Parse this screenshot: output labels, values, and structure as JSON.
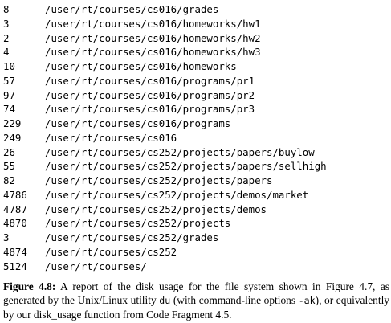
{
  "listing": [
    {
      "size": "8",
      "path": "/user/rt/courses/cs016/grades"
    },
    {
      "size": "3",
      "path": "/user/rt/courses/cs016/homeworks/hw1"
    },
    {
      "size": "2",
      "path": "/user/rt/courses/cs016/homeworks/hw2"
    },
    {
      "size": "4",
      "path": "/user/rt/courses/cs016/homeworks/hw3"
    },
    {
      "size": "10",
      "path": "/user/rt/courses/cs016/homeworks"
    },
    {
      "size": "57",
      "path": "/user/rt/courses/cs016/programs/pr1"
    },
    {
      "size": "97",
      "path": "/user/rt/courses/cs016/programs/pr2"
    },
    {
      "size": "74",
      "path": "/user/rt/courses/cs016/programs/pr3"
    },
    {
      "size": "229",
      "path": "/user/rt/courses/cs016/programs"
    },
    {
      "size": "249",
      "path": "/user/rt/courses/cs016"
    },
    {
      "size": "26",
      "path": "/user/rt/courses/cs252/projects/papers/buylow"
    },
    {
      "size": "55",
      "path": "/user/rt/courses/cs252/projects/papers/sellhigh"
    },
    {
      "size": "82",
      "path": "/user/rt/courses/cs252/projects/papers"
    },
    {
      "size": "4786",
      "path": "/user/rt/courses/cs252/projects/demos/market"
    },
    {
      "size": "4787",
      "path": "/user/rt/courses/cs252/projects/demos"
    },
    {
      "size": "4870",
      "path": "/user/rt/courses/cs252/projects"
    },
    {
      "size": "3",
      "path": "/user/rt/courses/cs252/grades"
    },
    {
      "size": "4874",
      "path": "/user/rt/courses/cs252"
    },
    {
      "size": "5124",
      "path": "/user/rt/courses/"
    }
  ],
  "caption": {
    "label": "Figure 4.8:",
    "text_1": " A report of the disk usage for the file system shown in Figure 4.7, as generated by the Unix/Linux utility ",
    "code_1": "du",
    "text_2": " (with command-line options ",
    "code_2": "-ak",
    "text_3": "), or equivalently by our disk_usage function from Code Fragment 4.5."
  }
}
